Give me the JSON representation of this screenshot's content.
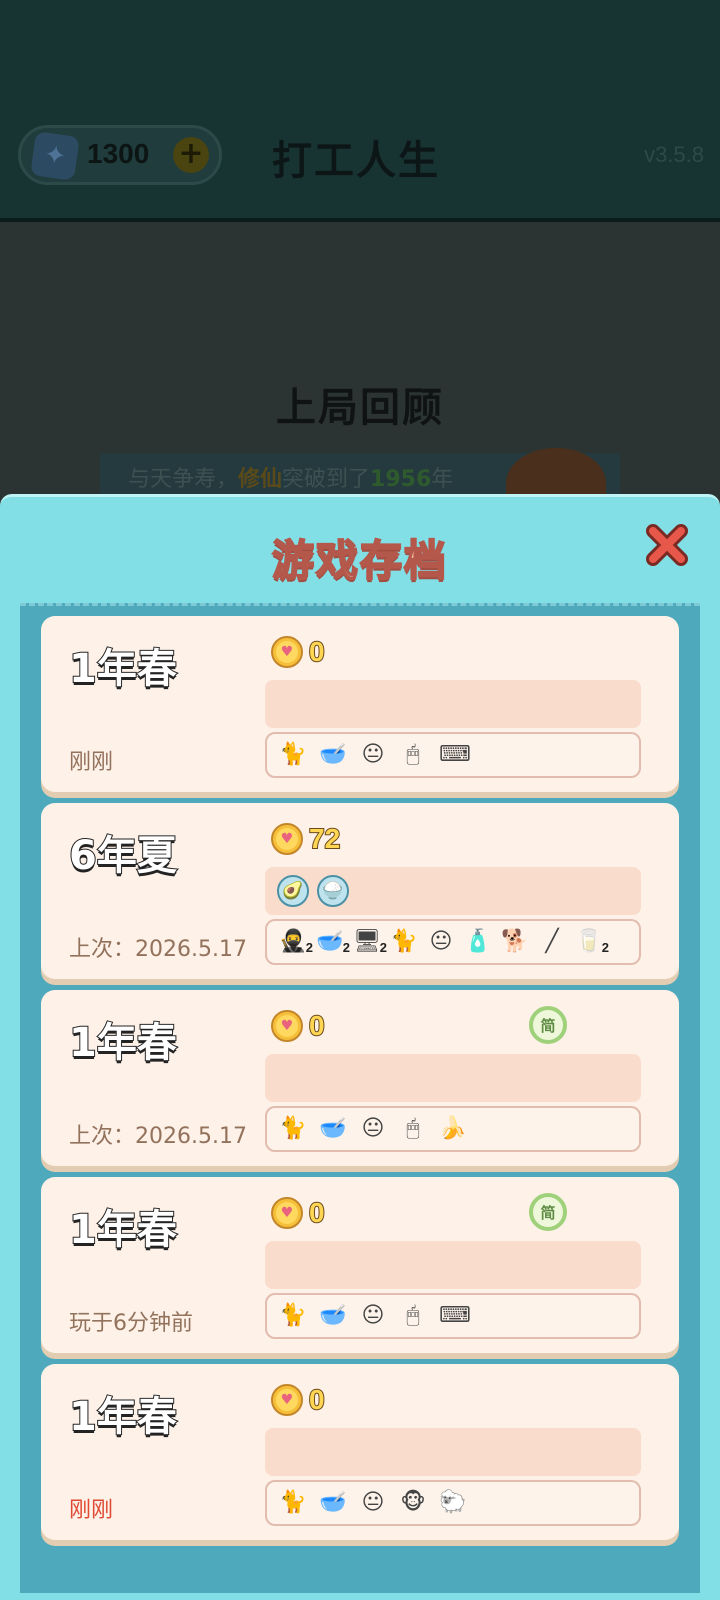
{
  "background": {
    "gems": "1300",
    "title": "打工人生",
    "version": "v3.5.8",
    "review_title": "上局回顾",
    "banner": {
      "prefix": "与天争寿，",
      "path": "修仙",
      "middle": "突破到了",
      "year": "1956",
      "suffix": "年"
    }
  },
  "modal": {
    "title": "游戏存档",
    "close_icon": "close-x-icon"
  },
  "saves": [
    {
      "season": "1年春",
      "coins": "0",
      "time": "刚刚",
      "time_color": "#93725c",
      "badge": "",
      "buffs": [],
      "items": [
        {
          "icon": "🐈",
          "name": "cat-icon",
          "count": ""
        },
        {
          "icon": "🥣",
          "name": "bowl-icon",
          "count": ""
        },
        {
          "icon": "😐",
          "name": "face-icon",
          "count": ""
        },
        {
          "icon": "🖱",
          "name": "mouse-icon",
          "count": ""
        },
        {
          "icon": "⌨",
          "name": "keyboard-icon",
          "count": ""
        }
      ]
    },
    {
      "season": "6年夏",
      "coins": "72",
      "time": "上次：2026.5.17",
      "time_color": "#93725c",
      "badge": "",
      "buffs": [
        {
          "icon": "🥑",
          "name": "avocado-buff-icon"
        },
        {
          "icon": "🍚",
          "name": "rice-buff-icon"
        }
      ],
      "items": [
        {
          "icon": "🥷",
          "name": "thief-icon",
          "count": "2"
        },
        {
          "icon": "🥣",
          "name": "bowl-icon",
          "count": "2"
        },
        {
          "icon": "🖥",
          "name": "computer-icon",
          "count": "2"
        },
        {
          "icon": "🐈",
          "name": "cat-icon",
          "count": ""
        },
        {
          "icon": "😐",
          "name": "face-icon",
          "count": ""
        },
        {
          "icon": "🧴",
          "name": "bottle-icon",
          "count": ""
        },
        {
          "icon": "🐕",
          "name": "dog-icon",
          "count": ""
        },
        {
          "icon": "╱",
          "name": "stick-icon",
          "count": ""
        },
        {
          "icon": "🥛",
          "name": "milk-icon",
          "count": "2"
        }
      ]
    },
    {
      "season": "1年春",
      "coins": "0",
      "time": "上次：2026.5.17",
      "time_color": "#93725c",
      "badge": "简",
      "buffs": [],
      "items": [
        {
          "icon": "🐈",
          "name": "cat-icon",
          "count": ""
        },
        {
          "icon": "🥣",
          "name": "bowl-icon",
          "count": ""
        },
        {
          "icon": "😐",
          "name": "face-icon",
          "count": ""
        },
        {
          "icon": "🖱",
          "name": "mouse-icon",
          "count": ""
        },
        {
          "icon": "🍌",
          "name": "banana-icon",
          "count": ""
        }
      ]
    },
    {
      "season": "1年春",
      "coins": "0",
      "time": "玩于6分钟前",
      "time_color": "#93725c",
      "badge": "简",
      "buffs": [],
      "items": [
        {
          "icon": "🐈",
          "name": "cat-icon",
          "count": ""
        },
        {
          "icon": "🥣",
          "name": "bowl-icon",
          "count": ""
        },
        {
          "icon": "😐",
          "name": "face-icon",
          "count": ""
        },
        {
          "icon": "🖱",
          "name": "mouse-icon",
          "count": ""
        },
        {
          "icon": "⌨",
          "name": "keyboard-icon",
          "count": ""
        }
      ]
    },
    {
      "season": "1年春",
      "coins": "0",
      "time": "刚刚",
      "time_color": "#e04a34",
      "badge": "",
      "buffs": [],
      "items": [
        {
          "icon": "🐈",
          "name": "cat-icon",
          "count": ""
        },
        {
          "icon": "🥣",
          "name": "bowl-icon",
          "count": ""
        },
        {
          "icon": "😐",
          "name": "face-icon",
          "count": ""
        },
        {
          "icon": "🐵",
          "name": "monkey-icon",
          "count": ""
        },
        {
          "icon": "🐑",
          "name": "sheep-icon",
          "count": ""
        }
      ]
    }
  ]
}
